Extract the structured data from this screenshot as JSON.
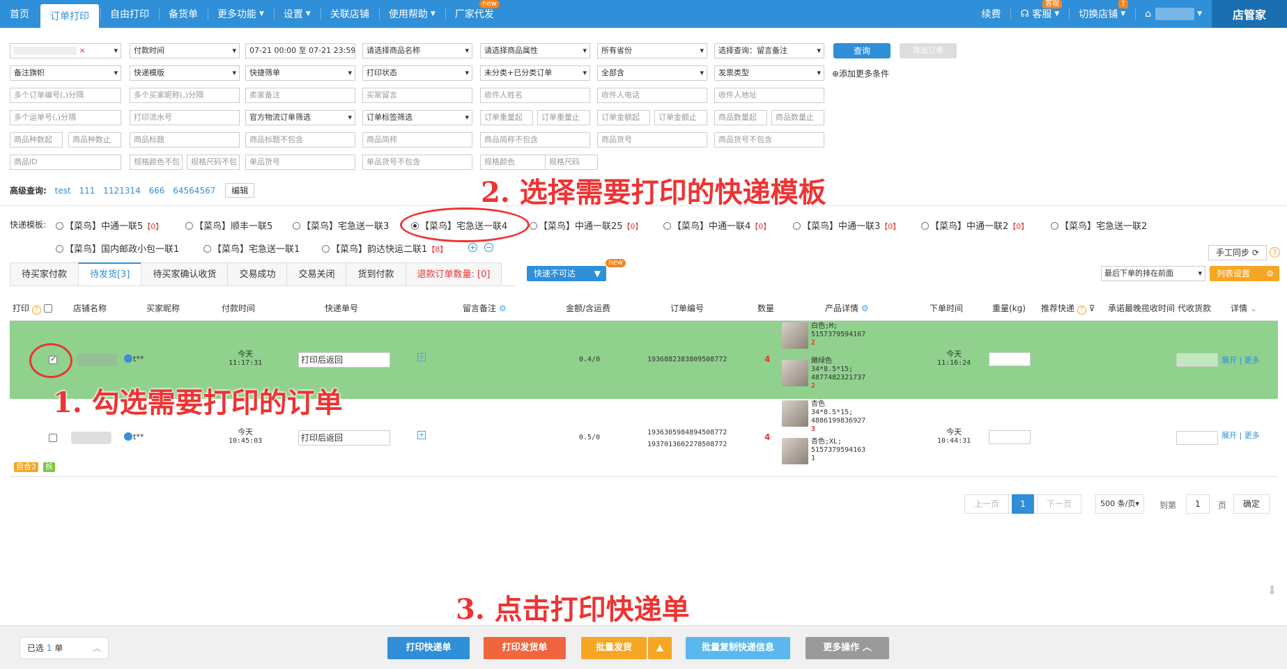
{
  "nav": {
    "items": [
      "首页",
      "订单打印",
      "自由打印",
      "备货单",
      "更多功能",
      "设置",
      "关联店铺",
      "使用帮助",
      "厂家代发"
    ],
    "active": "订单打印",
    "new_badge": "new",
    "renew": "续费",
    "service": "客服",
    "service_badge": "客服",
    "switch_shop": "切换店铺",
    "switch_badge": "1",
    "brand": "店管家"
  },
  "filters": {
    "row1": [
      "付款时间",
      "07-21 00:00 至 07-21 23:59",
      "请选择商品名称",
      "请选择商品属性",
      "所有省份",
      "选择查询：留言备注"
    ],
    "row2": [
      "备注旗帜",
      "快递模版",
      "快捷筛单",
      "打印状态",
      "未分类+已分类订单",
      "全部含",
      "发票类型"
    ],
    "add_more": "⊕添加更多条件",
    "row3": [
      "多个订单编号(,)分隔",
      "多个买家昵称(,)分隔",
      "卖家备注",
      "买家留言",
      "收件人姓名",
      "收件人电话",
      "收件人地址"
    ],
    "row4": [
      "多个运单号(,)分隔",
      "打印流水号",
      "官方物流订单筛选",
      "订单标签筛选",
      "订单重量起",
      "订单重量止",
      "订单金额起",
      "订单金额止",
      "商品数量起",
      "商品数量止"
    ],
    "row5": [
      "商品种数起",
      "商品种数止",
      "商品标题",
      "商品标题不包含",
      "商品简称",
      "商品简称不包含",
      "商品货号",
      "商品货号不包含"
    ],
    "row6": [
      "商品ID",
      "规格颜色不包",
      "规格尺码不包",
      "单品货号",
      "单品货号不包含",
      "规格颜色",
      "规格尺码"
    ],
    "query_btn": "查询",
    "export_btn": "导出订单"
  },
  "advanced": {
    "label": "高级查询:",
    "links": [
      "test",
      "111",
      "1121314",
      "666",
      "64564567"
    ],
    "edit": "编辑"
  },
  "courier": {
    "label": "快递模板:",
    "options": [
      {
        "name": "【菜鸟】中通一联5",
        "count": "【0】"
      },
      {
        "name": "【菜鸟】顺丰一联5",
        "count": ""
      },
      {
        "name": "【菜鸟】宅急送一联3",
        "count": ""
      },
      {
        "name": "【菜鸟】宅急送一联4",
        "count": ""
      },
      {
        "name": "【菜鸟】中通一联25",
        "count": "【0】"
      },
      {
        "name": "【菜鸟】中通一联4",
        "count": "【0】"
      },
      {
        "name": "【菜鸟】中通一联3",
        "count": "【0】"
      },
      {
        "name": "【菜鸟】中通一联2",
        "count": "【0】"
      },
      {
        "name": "【菜鸟】宅急送一联2",
        "count": ""
      },
      {
        "name": "【菜鸟】国内邮政小包一联1",
        "count": ""
      },
      {
        "name": "【菜鸟】宅急送一联1",
        "count": ""
      },
      {
        "name": "【菜鸟】韵达快运二联1",
        "count": "【8】"
      }
    ],
    "selected_index": 3,
    "manual_sync": "手工同步"
  },
  "tabs": [
    "待买家付款",
    "待发货[3]",
    "待买家确认收货",
    "交易成功",
    "交易关闭",
    "货到付款",
    "退款订单数量: [0]"
  ],
  "active_tab": "待发货[3]",
  "express_unreachable": "快速不可达",
  "express_new": "new",
  "sort_select": "最后下单的排在前面",
  "list_settings": "列表设置",
  "table": {
    "headers": [
      "打印",
      "店铺名称",
      "买家昵称",
      "付款时间",
      "快递单号",
      "留言备注",
      "金额/含运费",
      "订单编号",
      "数量",
      "产品详情",
      "下单时间",
      "重量(kg)",
      "推荐快递",
      "承诺最晚揽收时间",
      "代收货款",
      "详情"
    ],
    "rows": [
      {
        "checked": true,
        "buyer": "t**",
        "pay_day": "今天",
        "pay_time": "11:17:31",
        "tracking": "打印后返回",
        "amount": "0.4/0",
        "order_ids": [
          "1936882383809508772"
        ],
        "qty": "4",
        "products": [
          {
            "attr": "白色;M;",
            "code": "5157379594167",
            "n": "2"
          },
          {
            "attr": "嫩绿色",
            "sub": "34*8.5*15;",
            "code": "4877482321737",
            "n": "2"
          }
        ],
        "order_day": "今天",
        "order_time": "11:16:24",
        "expand": "展开",
        "more": "更多"
      },
      {
        "checked": false,
        "buyer": "t**",
        "pay_day": "今天",
        "pay_time": "10:45:03",
        "tracking": "打印后返回",
        "amount": "0.5/0",
        "order_ids": [
          "1936305984894508772",
          "1937013602278508772"
        ],
        "qty": "4",
        "products": [
          {
            "attr": "杏色",
            "sub": "34*8.5*15;",
            "code": "4886199836927",
            "n": "3"
          },
          {
            "attr": "杏色;XL;",
            "code": "5157379594163",
            "n": "1"
          }
        ],
        "order_day": "今天",
        "order_time": "10:44:31",
        "expand": "展开",
        "more": "更多",
        "tags": [
          "自合2",
          "拆"
        ]
      }
    ]
  },
  "pager": {
    "prev": "上一页",
    "current": "1",
    "next": "下一页",
    "per_page": "500 条/页",
    "goto": "到第",
    "page_input": "1",
    "page_unit": "页",
    "confirm": "确定"
  },
  "annotations": {
    "step1": "1. 勾选需要打印的订单",
    "step2": "2. 选择需要打印的快递模板",
    "step3": "3. 点击打印快递单"
  },
  "bottom": {
    "selected_prefix": "已选",
    "selected_count": "1",
    "selected_unit": "单",
    "print_express": "打印快递单",
    "print_invoice": "打印发货单",
    "batch_ship": "批量发货",
    "batch_copy": "批量复制快递信息",
    "more_ops": "更多操作"
  },
  "colors": {
    "brand_blue": "#2f8fd8",
    "selected_row": "#8fd18d",
    "annotation_red": "#e33333"
  }
}
